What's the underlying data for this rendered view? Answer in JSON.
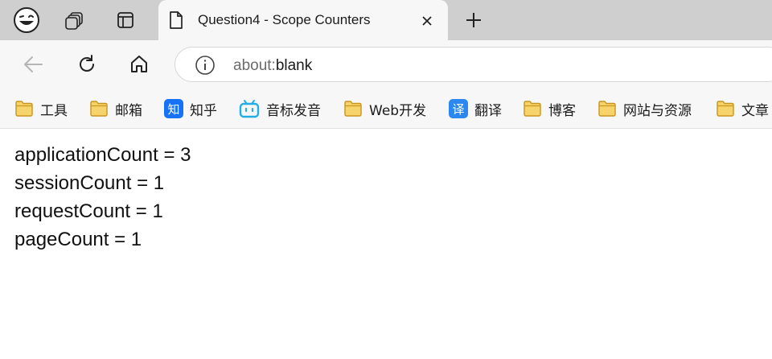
{
  "browser": {
    "tab": {
      "title": "Question4 - Scope Counters"
    },
    "address": {
      "scheme": "about:",
      "path": "blank"
    },
    "icons": {
      "profile": "smiley-icon",
      "workspaces": "workspaces-icon",
      "tab_actions": "tab-actions-icon",
      "favicon": "page-icon",
      "close": "close-icon",
      "new_tab": "plus-icon",
      "back": "back-arrow-icon",
      "refresh": "refresh-icon",
      "home": "home-icon",
      "info": "info-icon"
    }
  },
  "bookmarks": [
    {
      "label": "工具",
      "icon": "folder-icon"
    },
    {
      "label": "邮箱",
      "icon": "folder-icon"
    },
    {
      "label": "知乎",
      "icon": "zhihu-icon",
      "badge": "知"
    },
    {
      "label": "音标发音",
      "icon": "bilibili-icon"
    },
    {
      "label": "Web开发",
      "icon": "folder-icon"
    },
    {
      "label": "翻译",
      "icon": "translate-icon",
      "badge": "译"
    },
    {
      "label": "博客",
      "icon": "folder-icon"
    },
    {
      "label": "网站与资源",
      "icon": "folder-icon"
    },
    {
      "label": "文章",
      "icon": "folder-icon"
    }
  ],
  "page": {
    "lines": [
      "applicationCount = 3",
      "sessionCount = 1",
      "requestCount = 1",
      "pageCount = 1"
    ]
  },
  "colors": {
    "tabbar_bg": "#cfcfcf",
    "toolbar_bg": "#f7f7f7",
    "folder_fill": "#f6d36b",
    "folder_stroke": "#c9961f",
    "zhihu_blue": "#1772f6",
    "bilibili_blue": "#23ade5",
    "translate_blue": "#2b88f0"
  }
}
